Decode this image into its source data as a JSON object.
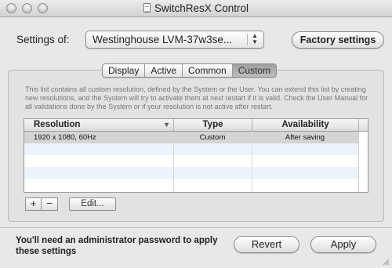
{
  "window": {
    "title": "SwitchResX Control"
  },
  "settings": {
    "label": "Settings of:",
    "display_selected": "Westinghouse LVM-37w3se...",
    "factory_button": "Factory settings"
  },
  "tabs": [
    {
      "label": "Display",
      "active": false
    },
    {
      "label": "Active",
      "active": false
    },
    {
      "label": "Common",
      "active": false
    },
    {
      "label": "Custom",
      "active": true
    }
  ],
  "description": "This list contains all custom resolution, defined by the System or the User. You can extend this list by creating new resolutions, and the System will try to activate them at next restart if it is valid. Check the User Manual for all validations done by the System or if your resolution is not active after restart.",
  "table": {
    "columns": [
      "Resolution",
      "Type",
      "Availability"
    ],
    "rows": [
      {
        "resolution": "1920 x 1080, 60Hz",
        "type": "Custom",
        "availability": "After saving"
      }
    ]
  },
  "buttons": {
    "add": "+",
    "remove": "−",
    "edit": "Edit...",
    "revert": "Revert",
    "apply": "Apply"
  },
  "footer": {
    "admin_note": "You'll need an administrator password to apply these settings"
  }
}
